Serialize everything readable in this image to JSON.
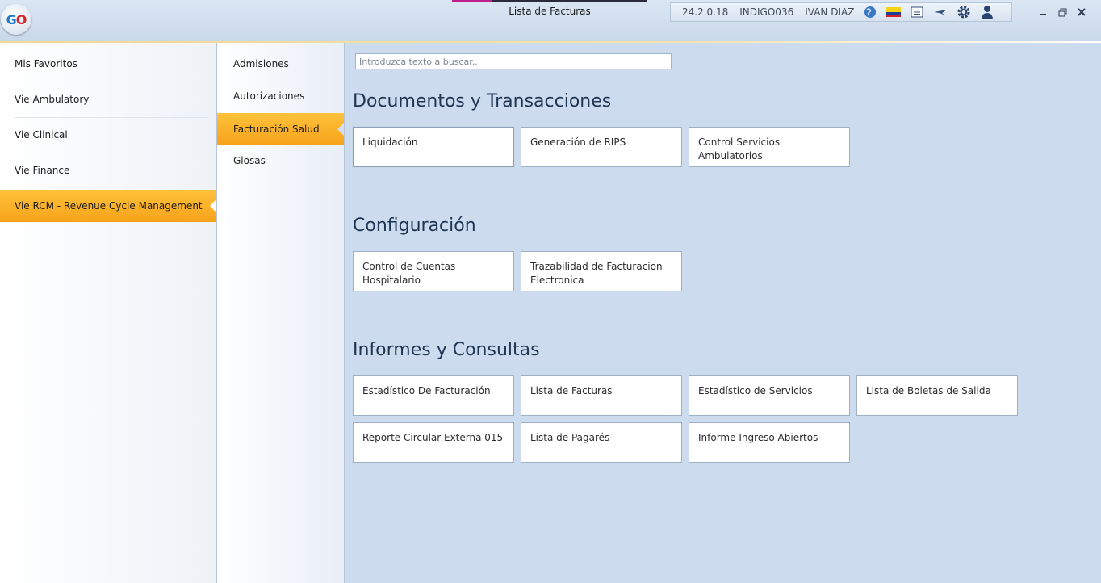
{
  "app": {
    "logo_text": "GO",
    "window_title": "Lista de Facturas",
    "version": "24.2.0.18",
    "server": "INDIGO036",
    "user": "IVAN DIAZ",
    "status_icons": [
      "globe-icon",
      "colombia-flag-icon",
      "list-icon",
      "plane-icon",
      "settings-gear-icon",
      "user-icon"
    ],
    "window_buttons": [
      "minimize-icon",
      "restore-icon",
      "close-icon"
    ]
  },
  "sidebar": {
    "items": [
      {
        "label": "Mis Favoritos"
      },
      {
        "label": "Vie Ambulatory"
      },
      {
        "label": "Vie Clinical"
      },
      {
        "label": "Vie Finance"
      },
      {
        "label": "Vie RCM - Revenue Cycle Management"
      }
    ],
    "selected_index": 4
  },
  "submenu": {
    "items": [
      {
        "label": "Admisiones"
      },
      {
        "label": "Autorizaciones"
      },
      {
        "label": "Facturación Salud"
      },
      {
        "label": "Glosas"
      }
    ],
    "selected_index": 2
  },
  "search": {
    "placeholder": "Introduzca texto a buscar..."
  },
  "sections": [
    {
      "title": "Documentos y Transacciones",
      "tiles": [
        "Liquidación",
        "Generación de RIPS",
        "Control Servicios Ambulatorios"
      ]
    },
    {
      "title": "Configuración",
      "tiles": [
        "Control de Cuentas Hospitalario",
        "Trazabilidad de Facturacion Electronica"
      ]
    },
    {
      "title": "Informes y Consultas",
      "tiles": [
        "Estadístico De Facturación",
        "Lista de Facturas",
        "Estadístico de Servicios",
        "Lista de Boletas de Salida",
        "Reporte Circular Externa 015",
        "Lista de Pagarés",
        "Informe Ingreso Abiertos"
      ]
    }
  ],
  "colors": {
    "accent": "#f8a91f",
    "background": "#ccdcee",
    "title_text": "#1f3552"
  }
}
